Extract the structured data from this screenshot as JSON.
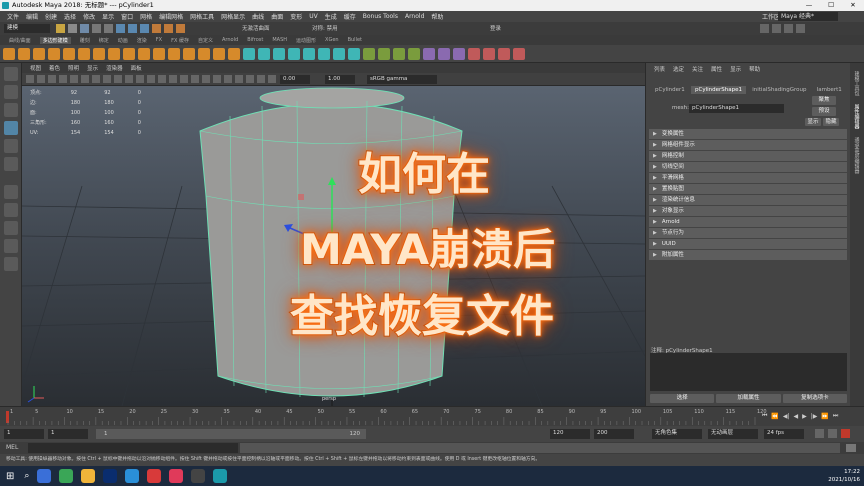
{
  "window": {
    "title": "Autodesk Maya 2018: 无标题*   ---   pCylinder1",
    "workspace_label": "工作区:",
    "workspace_value": "Maya 经典*"
  },
  "menubar": [
    "文件",
    "编辑",
    "创建",
    "选择",
    "修改",
    "显示",
    "窗口",
    "网格",
    "编辑网格",
    "网格工具",
    "网格显示",
    "曲线",
    "曲面",
    "变形",
    "UV",
    "生成",
    "缓存",
    "Bonus Tools",
    "Arnold",
    "帮助"
  ],
  "toolbar": {
    "mode": "建模",
    "no_live_surface": "无激活曲面",
    "symmetry": "对称: 禁用",
    "login": "登录"
  },
  "shelf_tabs": [
    "曲线/曲面",
    "多边形建模",
    "雕刻",
    "绑定",
    "动画",
    "渲染",
    "FX",
    "FX 缓存",
    "自定义",
    "Arnold",
    "Bifrost",
    "MASH",
    "运动图形",
    "XGen",
    "Bullet"
  ],
  "shelf_active_tab": "多边形建模",
  "viewport": {
    "menu": [
      "视图",
      "着色",
      "照明",
      "显示",
      "渲染器",
      "面板"
    ],
    "exposure": "0.00",
    "gamma": "1.00",
    "color_space": "sRGB gamma",
    "camera": "persp",
    "hud": [
      [
        "顶点:",
        "92",
        "92",
        "0"
      ],
      [
        "边:",
        "180",
        "180",
        "0"
      ],
      [
        "面:",
        "100",
        "100",
        "0"
      ],
      [
        "三角形:",
        "160",
        "160",
        "0"
      ],
      [
        "UV:",
        "154",
        "154",
        "0"
      ]
    ]
  },
  "overlay": {
    "line1": "如何在",
    "line2": "MAYA崩溃后",
    "line3": "查找恢复文件"
  },
  "attribute_editor": {
    "menu": [
      "列表",
      "选定",
      "关注",
      "属性",
      "显示",
      "帮助"
    ],
    "tabs": [
      "pCylinder1",
      "pCylinderShape1",
      "initialShadingGroup",
      "lambert1"
    ],
    "active_tab": "pCylinderShape1",
    "mesh_label": "mesh:",
    "mesh_value": "pCylinderShape1",
    "focus_btn": "聚焦",
    "presets_btn": "预设",
    "show_btn": "显示",
    "hide_btn": "隐藏",
    "sections": [
      "变换属性",
      "网格组件显示",
      "网格控制",
      "切线空间",
      "平滑网格",
      "置换贴图",
      "渲染统计信息",
      "对象显示",
      "Arnold",
      "节点行为",
      "UUID",
      "附加属性"
    ],
    "notes_label": "注释:  pCylinderShape1",
    "buttons": [
      "选择",
      "加载属性",
      "复制选项卡"
    ]
  },
  "timeline": {
    "ticks": [
      "1",
      "5",
      "10",
      "15",
      "20",
      "25",
      "30",
      "35",
      "40",
      "45",
      "50",
      "55",
      "60",
      "65",
      "70",
      "75",
      "80",
      "85",
      "90",
      "95",
      "100",
      "105",
      "110",
      "115",
      "120"
    ],
    "current": "1"
  },
  "range": {
    "start": "1",
    "start2": "1",
    "inner_start": "1",
    "inner_end": "120",
    "end": "120",
    "end2": "200",
    "char_set": "无角色集",
    "anim_layer": "无动画层",
    "fps": "24 fps"
  },
  "mel_label": "MEL",
  "helpline": "移动工具: 使用操纵器移动对象。按住 Ctrl + 鼠标中键并拖动以沿对抛移动组件。按住 Shift 键并拖动或按住平面控制柄以沿轴或平面移动。按住 Ctrl + Shift + 鼠标左键并拖动以将移动约束到表面或曲线。使用 D 或 Insert 键更改枢轴位置和轴方向。",
  "right_vtabs": [
    "建模工具包",
    "属性编辑器",
    "通道盒/层编辑器"
  ],
  "taskbar": {
    "time": "17:22",
    "date": "2021/10/16"
  },
  "colors": {
    "accent": "#5285a6",
    "overlay_glow": "#ff6a00",
    "wire": "#7fdcb5",
    "timeline_marker": "#c0392b"
  }
}
